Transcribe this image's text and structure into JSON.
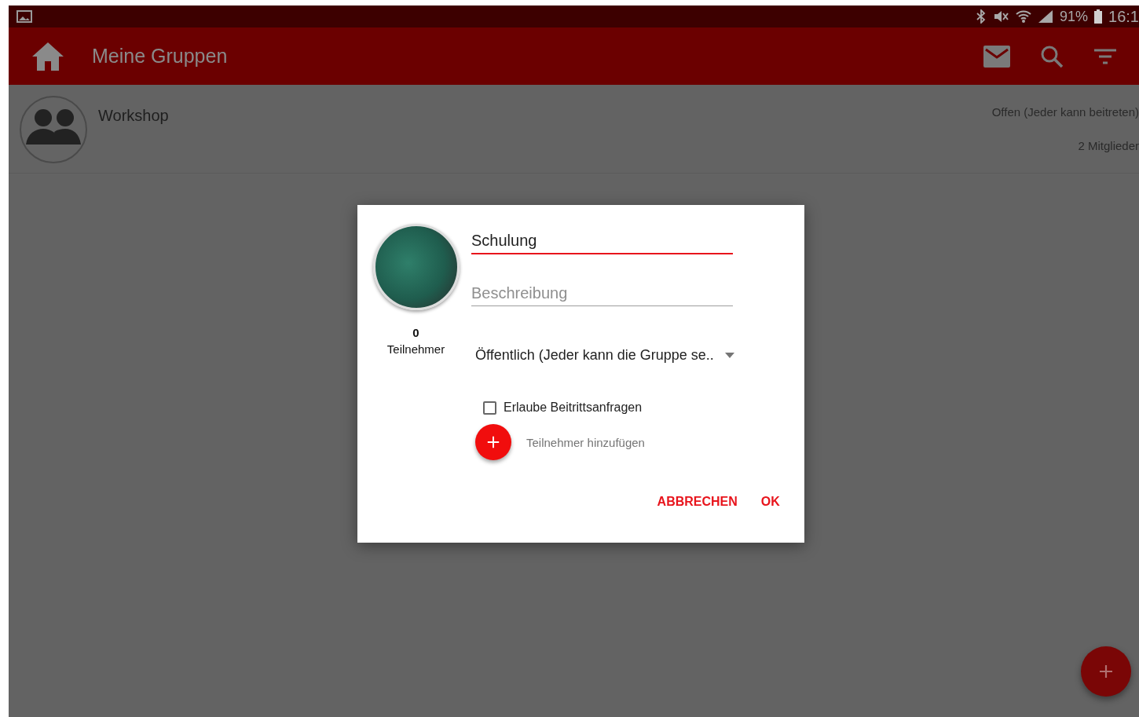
{
  "status_bar": {
    "battery": "91%",
    "time": "16:1"
  },
  "app_bar": {
    "title": "Meine Gruppen"
  },
  "groups": [
    {
      "name": "Workshop",
      "access": "Offen (Jeder kann beitreten)",
      "members": "2 Mitglieder"
    }
  ],
  "dialog": {
    "name_value": "Schulung",
    "description_placeholder": "Beschreibung",
    "participant_count": "0",
    "participant_label": "Teilnehmer",
    "visibility": "Öffentlich (Jeder kann die Gruppe se..",
    "allow_requests": {
      "label": "Erlaube Beitrittsanfragen",
      "checked": false
    },
    "add_participants": "Teilnehmer hinzufügen",
    "buttons": [
      "ABBRECHEN",
      "OK"
    ]
  }
}
